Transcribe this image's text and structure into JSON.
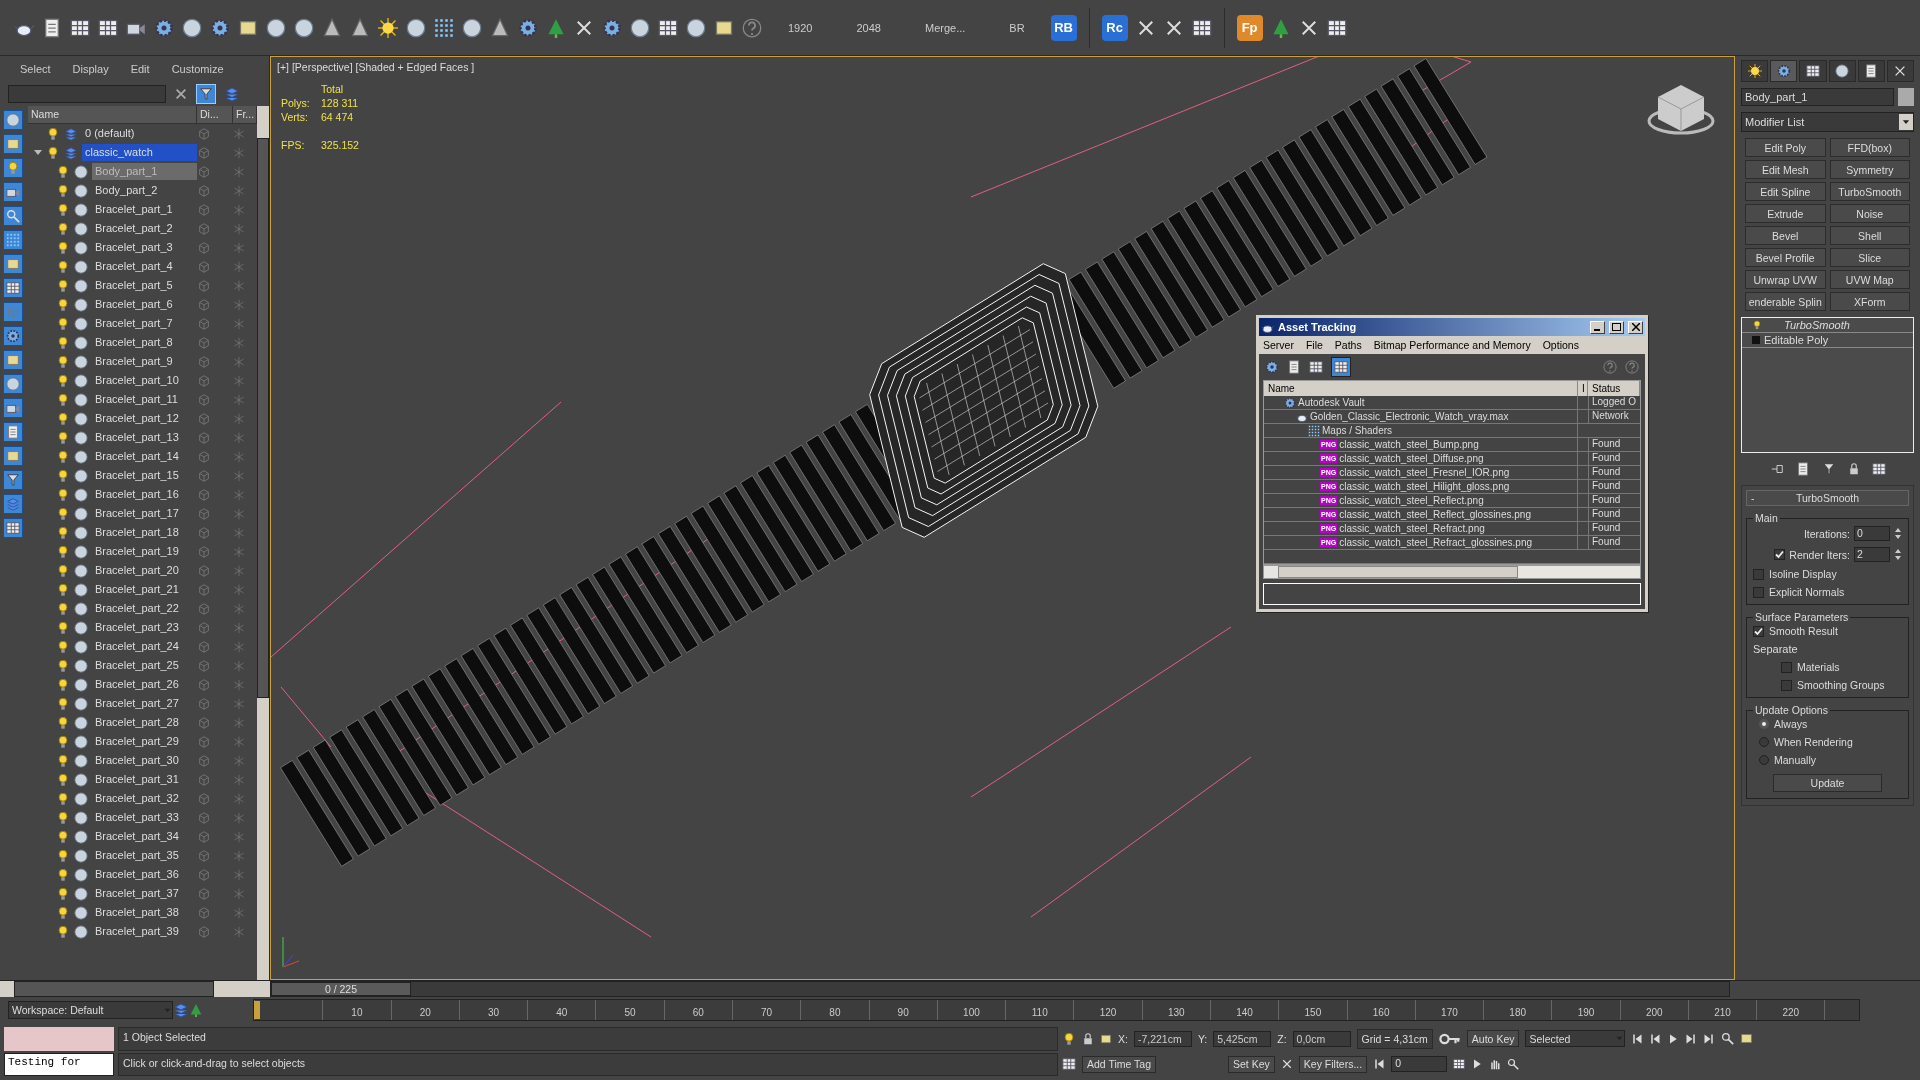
{
  "toolbar": {
    "readouts": [
      {
        "text": "1920"
      },
      {
        "text": "2048"
      },
      {
        "text": "Merge..."
      },
      {
        "text": "BR"
      }
    ],
    "badges": [
      {
        "text": "RB",
        "color": "#2a6fd6"
      },
      {
        "text": "Rc",
        "color": "#2a6fd6"
      },
      {
        "text": "Fp",
        "color": "#e0892a"
      }
    ]
  },
  "scene_explorer": {
    "menu": [
      "Select",
      "Display",
      "Edit",
      "Customize"
    ],
    "columns": [
      "Name",
      "Di...",
      "Fr..."
    ],
    "layers": [
      {
        "name": "0 (default)",
        "active": false
      },
      {
        "name": "classic_watch",
        "active": true,
        "expanded": true,
        "children": [
          {
            "name": "Body_part_1",
            "selected": true
          },
          {
            "name": "Body_part_2",
            "selected": false
          },
          {
            "name": "Bracelet_part_1",
            "selected": false
          },
          {
            "name": "Bracelet_part_2",
            "selected": false
          },
          {
            "name": "Bracelet_part_3",
            "selected": false
          },
          {
            "name": "Bracelet_part_4",
            "selected": false
          },
          {
            "name": "Bracelet_part_5",
            "selected": false
          },
          {
            "name": "Bracelet_part_6",
            "selected": false
          },
          {
            "name": "Bracelet_part_7",
            "selected": false
          },
          {
            "name": "Bracelet_part_8",
            "selected": false
          },
          {
            "name": "Bracelet_part_9",
            "selected": false
          },
          {
            "name": "Bracelet_part_10",
            "selected": false
          },
          {
            "name": "Bracelet_part_11",
            "selected": false
          },
          {
            "name": "Bracelet_part_12",
            "selected": false
          },
          {
            "name": "Bracelet_part_13",
            "selected": false
          },
          {
            "name": "Bracelet_part_14",
            "selected": false
          },
          {
            "name": "Bracelet_part_15",
            "selected": false
          },
          {
            "name": "Bracelet_part_16",
            "selected": false
          },
          {
            "name": "Bracelet_part_17",
            "selected": false
          },
          {
            "name": "Bracelet_part_18",
            "selected": false
          },
          {
            "name": "Bracelet_part_19",
            "selected": false
          },
          {
            "name": "Bracelet_part_20",
            "selected": false
          },
          {
            "name": "Bracelet_part_21",
            "selected": false
          },
          {
            "name": "Bracelet_part_22",
            "selected": false
          },
          {
            "name": "Bracelet_part_23",
            "selected": false
          },
          {
            "name": "Bracelet_part_24",
            "selected": false
          },
          {
            "name": "Bracelet_part_25",
            "selected": false
          },
          {
            "name": "Bracelet_part_26",
            "selected": false
          },
          {
            "name": "Bracelet_part_27",
            "selected": false
          },
          {
            "name": "Bracelet_part_28",
            "selected": false
          },
          {
            "name": "Bracelet_part_29",
            "selected": false
          },
          {
            "name": "Bracelet_part_30",
            "selected": false
          },
          {
            "name": "Bracelet_part_31",
            "selected": false
          },
          {
            "name": "Bracelet_part_32",
            "selected": false
          },
          {
            "name": "Bracelet_part_33",
            "selected": false
          },
          {
            "name": "Bracelet_part_34",
            "selected": false
          },
          {
            "name": "Bracelet_part_35",
            "selected": false
          },
          {
            "name": "Bracelet_part_36",
            "selected": false
          },
          {
            "name": "Bracelet_part_37",
            "selected": false
          },
          {
            "name": "Bracelet_part_38",
            "selected": false
          },
          {
            "name": "Bracelet_part_39",
            "selected": false
          }
        ]
      }
    ]
  },
  "viewport": {
    "label": "[+] [Perspective] [Shaded + Edged Faces ]",
    "stats": {
      "heading": "Total",
      "rows": [
        {
          "label": "Polys:",
          "value": "128 311"
        },
        {
          "label": "Verts:",
          "value": "64 474"
        }
      ]
    },
    "fps": {
      "label": "FPS:",
      "value": "325.152"
    }
  },
  "asset_tracking": {
    "title": "Asset Tracking",
    "menu": [
      "Server",
      "File",
      "Paths",
      "Bitmap Performance and Memory",
      "Options"
    ],
    "columns": [
      "Name",
      "I",
      "Status"
    ],
    "tree": [
      {
        "name": "Autodesk Vault",
        "status": "Logged O",
        "kind": "vault",
        "children": [
          {
            "name": "Golden_Classic_Electronic_Watch_vray.max",
            "status": "Network",
            "kind": "scene",
            "children": [
              {
                "name": "Maps / Shaders",
                "kind": "folder",
                "children": [
                  {
                    "name": "classic_watch_steel_Bump.png",
                    "status": "Found",
                    "kind": "file",
                    "badge": "PNG"
                  },
                  {
                    "name": "classic_watch_steel_Diffuse.png",
                    "status": "Found",
                    "kind": "file",
                    "badge": "PNG"
                  },
                  {
                    "name": "classic_watch_steel_Fresnel_IOR.png",
                    "status": "Found",
                    "kind": "file",
                    "badge": "PNG"
                  },
                  {
                    "name": "classic_watch_steel_Hilight_gloss.png",
                    "status": "Found",
                    "kind": "file",
                    "badge": "PNG"
                  },
                  {
                    "name": "classic_watch_steel_Reflect.png",
                    "status": "Found",
                    "kind": "file",
                    "badge": "PNG"
                  },
                  {
                    "name": "classic_watch_steel_Reflect_glossines.png",
                    "status": "Found",
                    "kind": "file",
                    "badge": "PNG"
                  },
                  {
                    "name": "classic_watch_steel_Refract.png",
                    "status": "Found",
                    "kind": "file",
                    "badge": "PNG"
                  },
                  {
                    "name": "classic_watch_steel_Refract_glossines.png",
                    "status": "Found",
                    "kind": "file",
                    "badge": "PNG"
                  }
                ]
              }
            ]
          }
        ]
      }
    ]
  },
  "command_panel": {
    "tabs": [
      {
        "selected": false
      },
      {
        "selected": true
      },
      {
        "selected": false
      },
      {
        "selected": false
      },
      {
        "selected": false
      },
      {
        "selected": false
      }
    ],
    "object_name": "Body_part_1",
    "modifier_list": "Modifier List",
    "modifiers": [
      "Edit Poly",
      "FFD(box)",
      "Edit Mesh",
      "Symmetry",
      "Edit Spline",
      "TurboSmooth",
      "Extrude",
      "Noise",
      "Bevel",
      "Shell",
      "Bevel Profile",
      "Slice",
      "Unwrap UVW",
      "UVW Map",
      "enderable Splin",
      "XForm"
    ],
    "stack": [
      {
        "name": "TurboSmooth",
        "kind": "modifier"
      },
      {
        "name": "Editable Poly",
        "kind": "base"
      }
    ],
    "rollout": {
      "title": "TurboSmooth",
      "collapse": "-",
      "main": {
        "title": "Main",
        "iterations": {
          "label": "Iterations:",
          "value": "0"
        },
        "render_iters": {
          "label": "Render Iters:",
          "value": "2",
          "checked": true
        },
        "options": [
          {
            "label": "Isoline Display",
            "checked": false
          },
          {
            "label": "Explicit Normals",
            "checked": false
          }
        ]
      },
      "surface": {
        "title": "Surface Parameters",
        "smooth_result": {
          "label": "Smooth Result",
          "checked": true
        },
        "separate": "Separate",
        "options": [
          {
            "label": "Materials",
            "checked": false
          },
          {
            "label": "Smoothing Groups",
            "checked": false
          }
        ]
      },
      "update": {
        "title": "Update Options",
        "options": [
          {
            "label": "Always",
            "selected": true
          },
          {
            "label": "When Rendering",
            "selected": false
          },
          {
            "label": "Manually",
            "selected": false
          }
        ],
        "button": "Update"
      }
    }
  },
  "time_slider": {
    "text": "0 / 225"
  },
  "workspace": "Workspace: Default",
  "timeline": {
    "ticks": [
      "10",
      "20",
      "30",
      "40",
      "50",
      "60",
      "70",
      "80",
      "90",
      "100",
      "110",
      "120",
      "130",
      "140",
      "150",
      "160",
      "170",
      "180",
      "190",
      "200",
      "210",
      "220"
    ]
  },
  "status": {
    "script": "Testing for",
    "selection": "1 Object Selected",
    "prompt": "Click or click-and-drag to select objects",
    "coords": [
      {
        "label": "X:",
        "value": "-7,221cm"
      },
      {
        "label": "Y:",
        "value": "5,425cm"
      },
      {
        "label": "Z:",
        "value": "0,0cm"
      }
    ],
    "grid": "Grid = 4,31cm",
    "add_time_tag": "Add Time Tag",
    "auto_key": "Auto Key",
    "set_key": "Set Key",
    "key_mode": "Selected",
    "key_filters": "Key Filters...",
    "frame": "0"
  }
}
